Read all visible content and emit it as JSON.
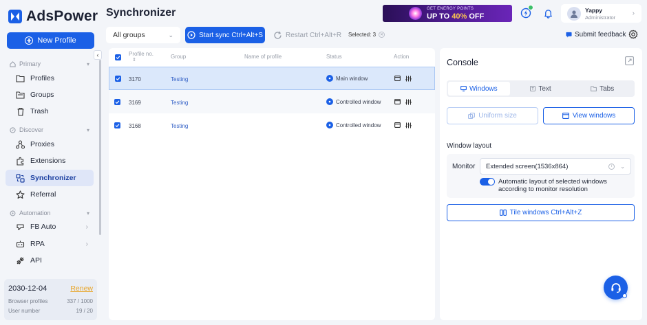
{
  "app": {
    "logo_text": "AdsPower",
    "page_title": "Synchronizer"
  },
  "sidebar": {
    "new_profile": "New Profile",
    "sections": {
      "primary": "Primary",
      "discover": "Discover",
      "automation": "Automation"
    },
    "items": [
      {
        "label": "Profiles",
        "icon": "folder-icon"
      },
      {
        "label": "Groups",
        "icon": "folders-icon"
      },
      {
        "label": "Trash",
        "icon": "trash-icon"
      },
      {
        "label": "Proxies",
        "icon": "proxies-icon"
      },
      {
        "label": "Extensions",
        "icon": "extensions-icon"
      },
      {
        "label": "Synchronizer",
        "icon": "synchronizer-icon",
        "active": true
      },
      {
        "label": "Referral",
        "icon": "star-icon"
      },
      {
        "label": "FB Auto",
        "icon": "fb-auto-icon"
      },
      {
        "label": "RPA",
        "icon": "rpa-icon"
      },
      {
        "label": "API",
        "icon": "api-icon"
      }
    ],
    "footer": {
      "date": "2030-12-04",
      "renew": "Renew",
      "browser_profiles_label": "Browser profiles",
      "browser_profiles_value": "337 / 1000",
      "user_number_label": "User number",
      "user_number_value": "19 / 20"
    }
  },
  "header": {
    "banner": {
      "line1": "GET ENERGY POINTS",
      "line2_prefix": "UP TO ",
      "line2_pct": "40%",
      "line2_suffix": " OFF"
    },
    "user": {
      "name": "Yappy",
      "role": "Administrator"
    }
  },
  "toolbar": {
    "groups_select": "All groups",
    "start_sync": "Start sync Ctrl+Alt+S",
    "restart": "Restart Ctrl+Alt+R",
    "selected": "Selected: 3",
    "feedback": "Submit feedback"
  },
  "table": {
    "columns": {
      "profile_no": "Profile no.",
      "group": "Group",
      "name": "Name of profile",
      "status": "Status",
      "action": "Action"
    },
    "rows": [
      {
        "no": "3170",
        "group": "Testing",
        "name": "",
        "status": "Main window"
      },
      {
        "no": "3169",
        "group": "Testing",
        "name": "",
        "status": "Controlled window"
      },
      {
        "no": "3168",
        "group": "Testing",
        "name": "",
        "status": "Controlled window"
      }
    ]
  },
  "console": {
    "title": "Console",
    "tabs": [
      "Windows",
      "Text",
      "Tabs"
    ],
    "uniform_size": "Uniform size",
    "view_windows": "View windows",
    "window_layout": "Window layout",
    "monitor_label": "Monitor",
    "monitor_value": "Extended screen(1536x864)",
    "auto_layout": "Automatic layout of selected windows according to monitor resolution",
    "tile_windows": "Tile windows Ctrl+Alt+Z"
  },
  "colors": {
    "accent": "#1b60e6",
    "renew": "#e8a323",
    "active_nav_bg": "#dfe6f8",
    "selected_row_bg": "#dbe8fb"
  }
}
